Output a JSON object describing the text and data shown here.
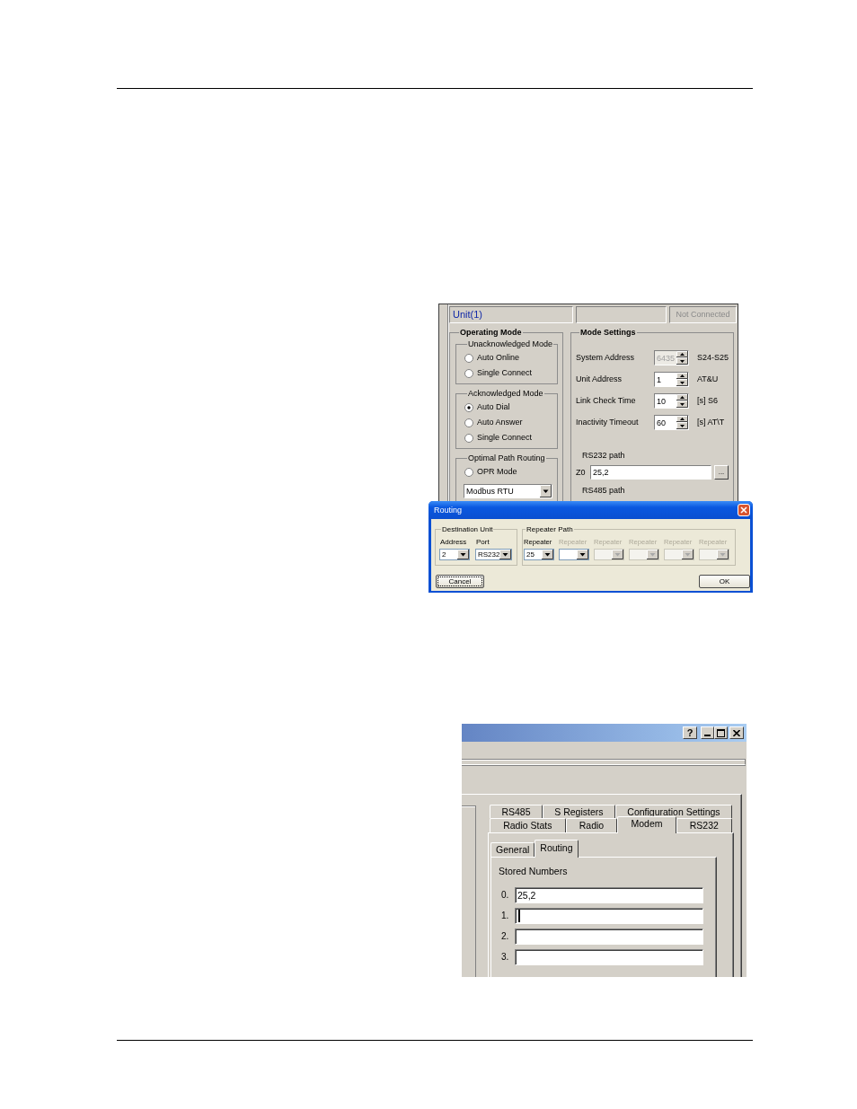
{
  "unit_panel": {
    "title": "Unit(1)",
    "status": "Not Connected",
    "operating_mode": {
      "title": "Operating Mode",
      "groups": [
        {
          "title": "Unacknowledged Mode",
          "options": [
            {
              "label": "Auto Online",
              "selected": false
            },
            {
              "label": "Single Connect",
              "selected": false
            }
          ]
        },
        {
          "title": "Acknowledged Mode",
          "options": [
            {
              "label": "Auto Dial",
              "selected": true
            },
            {
              "label": "Auto Answer",
              "selected": false
            },
            {
              "label": "Single Connect",
              "selected": false
            }
          ]
        },
        {
          "title": "Optimal Path Routing",
          "options": [
            {
              "label": "OPR Mode",
              "selected": false
            }
          ],
          "dropdown": {
            "value": "Modbus RTU"
          }
        }
      ]
    },
    "mode_settings": {
      "title": "Mode Settings",
      "fields": [
        {
          "label": "System Address",
          "value": "6435",
          "disabled": true,
          "register": "S24-S25"
        },
        {
          "label": "Unit Address",
          "value": "1",
          "disabled": false,
          "register": "AT&U"
        },
        {
          "label": "Link Check Time",
          "value": "10",
          "disabled": false,
          "register": "[s] S6"
        },
        {
          "label": "Inactivity Timeout",
          "value": "60",
          "disabled": false,
          "register": "[s] AT\\T"
        }
      ],
      "rs232_path": {
        "label": "RS232 path",
        "prefix": "Z0",
        "value": "25,2",
        "button": "..."
      },
      "rs485_path": {
        "label": "RS485 path"
      }
    }
  },
  "routing_dialog": {
    "title": "Routing",
    "destination_unit": {
      "title": "Destination Unit",
      "fields": [
        {
          "label": "Address",
          "value": "2",
          "disabled": false
        },
        {
          "label": "Port",
          "value": "RS232",
          "disabled": false
        }
      ]
    },
    "repeater_path": {
      "title": "Repeater Path",
      "repeaters": [
        {
          "label": "Repeater",
          "value": "25",
          "disabled": false,
          "label_disabled": false
        },
        {
          "label": "Repeater",
          "disabled": false,
          "label_disabled": true
        },
        {
          "label": "Repeater",
          "disabled": true,
          "label_disabled": true
        },
        {
          "label": "Repeater",
          "disabled": true,
          "label_disabled": true
        },
        {
          "label": "Repeater",
          "disabled": true,
          "label_disabled": true
        },
        {
          "label": "Repeater",
          "disabled": true,
          "label_disabled": true
        }
      ]
    },
    "buttons": [
      {
        "label": "Cancel",
        "focused": true
      },
      {
        "label": "OK",
        "focused": false
      }
    ]
  },
  "config_window": {
    "help_button": "?",
    "tab_rows": [
      {
        "tabs": [
          {
            "label": "RS485",
            "selected": false
          },
          {
            "label": "S Registers",
            "selected": false
          },
          {
            "label": "Configuration Settings",
            "selected": false
          }
        ]
      },
      {
        "tabs": [
          {
            "label": "Radio Stats",
            "selected": false
          },
          {
            "label": "Radio",
            "selected": false
          },
          {
            "label": "Modem",
            "selected": true
          },
          {
            "label": "RS232",
            "selected": false
          }
        ]
      }
    ],
    "subtabs": [
      {
        "label": "General",
        "selected": false
      },
      {
        "label": "Routing",
        "selected": true
      }
    ],
    "stored_numbers": {
      "title": "Stored Numbers",
      "entries": [
        {
          "index": "0.",
          "value": "25,2",
          "focused": false
        },
        {
          "index": "1.",
          "focused": true
        },
        {
          "index": "2.",
          "focused": false
        },
        {
          "index": "3.",
          "focused": false
        }
      ]
    }
  }
}
